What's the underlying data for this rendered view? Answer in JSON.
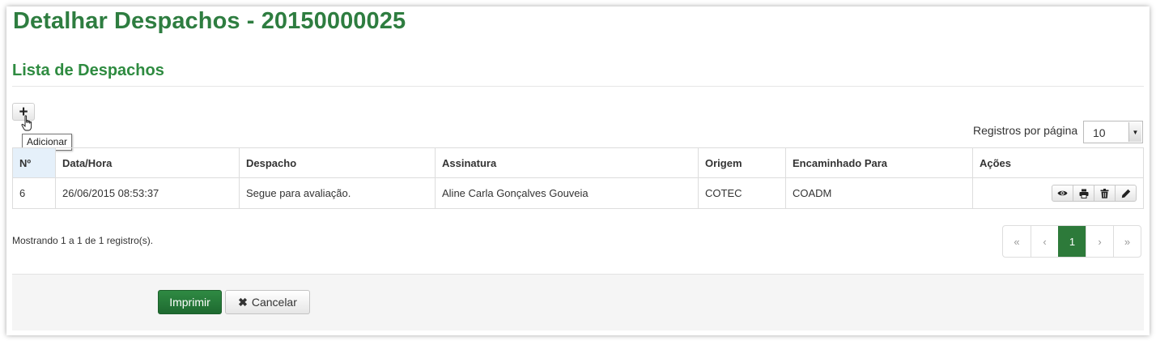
{
  "page": {
    "title": "Detalhar Despachos - 20150000025",
    "section_title": "Lista de Despachos"
  },
  "toolbar": {
    "add_icon": "plus-icon",
    "add_tooltip": "Adicionar"
  },
  "per_page": {
    "label": "Registros por página",
    "value": "10"
  },
  "table": {
    "headers": [
      "Nº",
      "Data/Hora",
      "Despacho",
      "Assinatura",
      "Origem",
      "Encaminhado Para",
      "Ações"
    ],
    "rows": [
      {
        "num": "6",
        "datetime": "26/06/2015 08:53:37",
        "despacho": "Segue para avaliação.",
        "assinatura": "Aline Carla Gonçalves Gouveia",
        "origem": "COTEC",
        "encaminhado": "COADM"
      }
    ],
    "row_actions": [
      "eye-icon",
      "print-icon",
      "trash-icon",
      "pencil-icon"
    ]
  },
  "info": "Mostrando 1 a 1 de 1 registro(s).",
  "pagination": {
    "first": "«",
    "prev": "‹",
    "current": "1",
    "next": "›",
    "last": "»"
  },
  "footer": {
    "print_label": "Imprimir",
    "cancel_label": "Cancelar"
  },
  "colors": {
    "brand_green": "#2e7d40",
    "active_page": "#2d7a3a"
  }
}
